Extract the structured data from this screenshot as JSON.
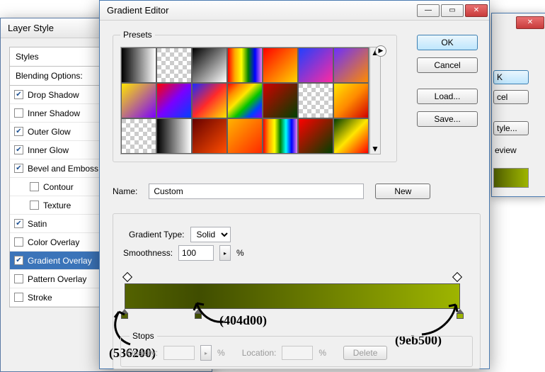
{
  "bg": {},
  "win2": {
    "ok": "K",
    "cancel": "cel",
    "style": "tyle...",
    "preview": "eview"
  },
  "layerStyle": {
    "title": "Layer Style",
    "stylesHeader": "Styles",
    "blending": "Blending Options:",
    "rows": [
      {
        "label": "Drop Shadow",
        "checked": true,
        "indent": false
      },
      {
        "label": "Inner Shadow",
        "checked": false,
        "indent": false
      },
      {
        "label": "Outer Glow",
        "checked": true,
        "indent": false
      },
      {
        "label": "Inner Glow",
        "checked": true,
        "indent": false
      },
      {
        "label": "Bevel and Emboss",
        "checked": true,
        "indent": false
      },
      {
        "label": "Contour",
        "checked": false,
        "indent": true
      },
      {
        "label": "Texture",
        "checked": false,
        "indent": true
      },
      {
        "label": "Satin",
        "checked": true,
        "indent": false
      },
      {
        "label": "Color Overlay",
        "checked": false,
        "indent": false
      },
      {
        "label": "Gradient Overlay",
        "checked": true,
        "indent": false,
        "selected": true
      },
      {
        "label": "Pattern Overlay",
        "checked": false,
        "indent": false
      },
      {
        "label": "Stroke",
        "checked": false,
        "indent": false
      }
    ]
  },
  "gradEditor": {
    "title": "Gradient Editor",
    "buttons": {
      "ok": "OK",
      "cancel": "Cancel",
      "load": "Load...",
      "save": "Save...",
      "new": "New",
      "delete": "Delete"
    },
    "presetsLabel": "Presets",
    "nameLabel": "Name:",
    "nameValue": "Custom",
    "typeLabel": "Gradient Type:",
    "typeValue": "Solid",
    "smoothLabel": "Smoothness:",
    "smoothValue": "100",
    "percent": "%",
    "stopsLabel": "Stops",
    "opacityLabel": "Opacity:",
    "locationLabel": "Location:",
    "annotations": {
      "left": "(536200)",
      "mid": "(404d00)",
      "right": "(9eb500)"
    },
    "gradientStops": [
      {
        "pos": 0,
        "color": "#536200"
      },
      {
        "pos": 22,
        "color": "#404d00"
      },
      {
        "pos": 100,
        "color": "#9eb500"
      }
    ],
    "presetSwatches": [
      "linear-gradient(90deg,#000,#fff)",
      "repeating-conic-gradient(#ccc 0 25%, #fff 0 50%) 0/12px 12px",
      "linear-gradient(135deg,#000,#fff)",
      "linear-gradient(90deg,red,orange,yellow,green,blue,violet)",
      "linear-gradient(135deg,#ff0000,#ffd400)",
      "linear-gradient(135deg,#2040ff,#ff2aa0)",
      "linear-gradient(135deg,#6b2fff,#ff8a00)",
      "linear-gradient(135deg,#ffe600,#7a00ff)",
      "linear-gradient(135deg,#ff0000,#7a00ff,#0040ff)",
      "linear-gradient(135deg,#1a2aff,#ff2a2a,#ffe600)",
      "linear-gradient(135deg,#ff0000,#ff8a00,#ffe600,#00c400,#0040ff,#7a00ff)",
      "linear-gradient(135deg,#d00000,#004000)",
      "repeating-conic-gradient(#ccc 0 25%, #fff 0 50%) 0/12px 12px",
      "linear-gradient(135deg,#ffe600,#ff8a00,#d00000)",
      "repeating-conic-gradient(#ccc 0 25%, #fff 0 50%) 0/12px 12px",
      "linear-gradient(90deg,#000,#fff)",
      "linear-gradient(135deg,#660000,#ff4d00)",
      "linear-gradient(135deg,#ffb300,#ff2a00)",
      "linear-gradient(90deg,red,orange,yellow,green,cyan,blue,violet)",
      "linear-gradient(135deg,#ff0000,#004000)",
      "linear-gradient(135deg,#003a00,#ffe600,#ff0000)"
    ]
  }
}
